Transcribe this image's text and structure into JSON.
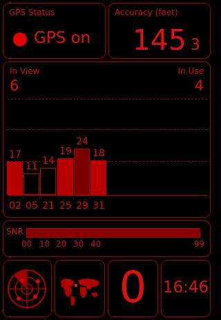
{
  "gps_status": {
    "label": "GPS Status",
    "value": "GPS on"
  },
  "accuracy": {
    "label": "Accuracy (feet)",
    "value": "145",
    "sub": "3"
  },
  "satellites": {
    "in_view_label": "In View",
    "in_view": "6",
    "in_use_label": "In Use",
    "in_use": "4",
    "bars": [
      {
        "prn": "02",
        "snr": "17",
        "snr_value": 17,
        "state": "used"
      },
      {
        "prn": "05",
        "snr": "11",
        "snr_value": 11,
        "state": "unused"
      },
      {
        "prn": "21",
        "snr": "14",
        "snr_value": 14,
        "state": "unused"
      },
      {
        "prn": "25",
        "snr": "19",
        "snr_value": 19,
        "state": "used"
      },
      {
        "prn": "29",
        "snr": "24",
        "snr_value": 24,
        "state": "dim"
      },
      {
        "prn": "31",
        "snr": "18",
        "snr_value": 18,
        "state": "used"
      }
    ]
  },
  "snr_scale": {
    "label": "SNR",
    "ticks": [
      "00",
      "10",
      "20",
      "30",
      "40"
    ],
    "max": "99"
  },
  "tiles": {
    "satellite_count": "0",
    "clock": "16:46"
  },
  "colors": {
    "accent": "#cc1111",
    "border": "#9a0000",
    "background": "#000000"
  },
  "icons": {
    "radar": "radar-icon",
    "map": "world-map-icon"
  }
}
